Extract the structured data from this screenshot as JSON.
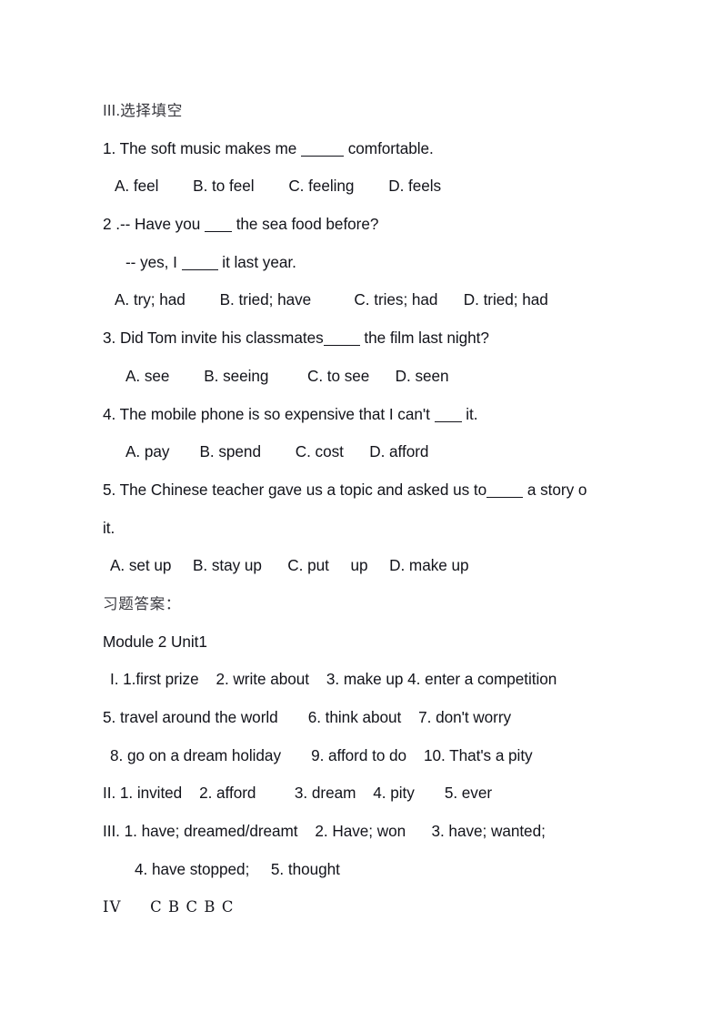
{
  "document": {
    "page_background": "#ffffff",
    "text_color": "#12131a",
    "heading_color": "#3a3a40"
  },
  "section_heading": {
    "numeral": "III.",
    "title": "选择填空"
  },
  "questions": [
    {
      "stem_before": "1. The soft music makes me ",
      "stem_after": " comfortable.",
      "options_line": "A. feel        B. to feel        C. feeling        D. feels"
    },
    {
      "stem_before": "2 .-- Have you ",
      "stem_after": " the sea food before?",
      "reply_before": "-- yes, I ",
      "reply_after": " it last year.",
      "options_line": "A. try; had        B. tried; have          C. tries; had      D. tried; had"
    },
    {
      "stem_before": "3. Did Tom invite his classmates",
      "stem_after": " the film last night?",
      "options_line": "A. see        B. seeing         C. to see      D. seen"
    },
    {
      "stem_before": "4. The mobile phone is so expensive that I can't ",
      "stem_after": " it.",
      "options_line": "A. pay       B. spend        C. cost      D. afford"
    },
    {
      "stem_before": "5. The Chinese teacher gave us a topic and asked us to",
      "stem_after": " a story o",
      "continuation": "it.",
      "options_line": "A. set up     B. stay up      C. put     up     D. make up"
    }
  ],
  "answers": {
    "heading": "习题答案：",
    "module_title": "Module 2 Unit1",
    "lines": [
      "I. 1.first prize    2. write about    3. make up 4. enter a competition",
      "5. travel around the world       6. think about    7. don't worry",
      "8. go on a dream holiday       9. afford to do    10. That's a pity",
      "II. 1. invited    2. afford         3. dream    4. pity       5. ever",
      "III. 1. have; dreamed/dreamt    2. Have; won      3. have; wanted;",
      "4. have stopped;     5. thought"
    ],
    "final_numeral": "IV",
    "final_keys": "C B C B C"
  }
}
